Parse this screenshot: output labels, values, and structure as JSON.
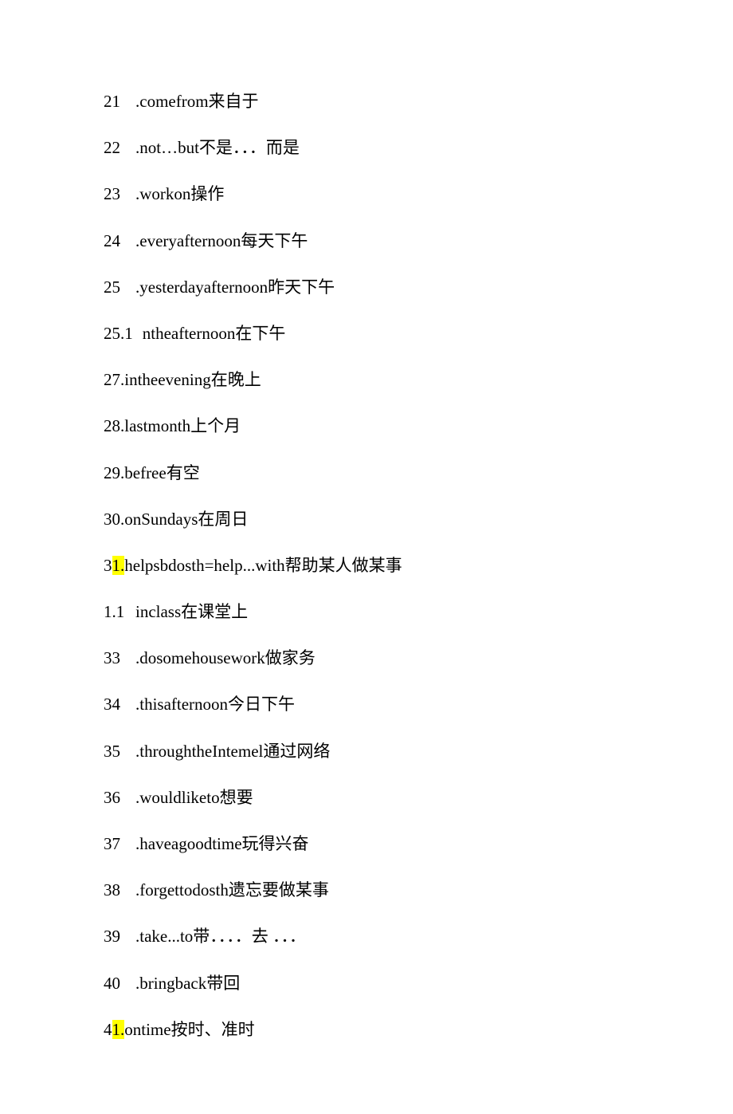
{
  "lines": [
    {
      "num": "21",
      "spaced": true,
      "prehl": "",
      "hl": "",
      "rest": ".comefrom来自于"
    },
    {
      "num": "22",
      "spaced": true,
      "prehl": "",
      "hl": "",
      "rest": ".not…but不是．．．而是"
    },
    {
      "num": "23",
      "spaced": true,
      "prehl": "",
      "hl": "",
      "rest": ".workon操作"
    },
    {
      "num": "24",
      "spaced": true,
      "prehl": "",
      "hl": "",
      "rest": ".everyafternoon每天下午"
    },
    {
      "num": "25",
      "spaced": true,
      "prehl": "",
      "hl": "",
      "rest": ".yesterdayafternoon昨天下午"
    },
    {
      "num": "25.1",
      "spaced": true,
      "prehl": "",
      "hl": "",
      "rest": "ntheafternoon在下午"
    },
    {
      "num": "",
      "spaced": false,
      "prehl": "27.intheevening在晚上",
      "hl": "",
      "rest": ""
    },
    {
      "num": "",
      "spaced": false,
      "prehl": "28.lastmonth上个月",
      "hl": "",
      "rest": ""
    },
    {
      "num": "",
      "spaced": false,
      "prehl": "29.befree有空",
      "hl": "",
      "rest": ""
    },
    {
      "num": "",
      "spaced": false,
      "prehl": "30.onSundays在周日",
      "hl": "",
      "rest": ""
    },
    {
      "num": "",
      "spaced": false,
      "prehl": "3",
      "hl": "1.",
      "rest": "helpsbdosth=help...with帮助某人做某事"
    },
    {
      "num": "1.1",
      "spaced": true,
      "prehl": "",
      "hl": "",
      "rest": "inclass在课堂上"
    },
    {
      "num": "33",
      "spaced": true,
      "prehl": "",
      "hl": "",
      "rest": ".dosomehousework做家务"
    },
    {
      "num": "34",
      "spaced": true,
      "prehl": "",
      "hl": "",
      "rest": ".thisafternoon今日下午"
    },
    {
      "num": "35",
      "spaced": true,
      "prehl": "",
      "hl": "",
      "rest": ".throughtheIntemel通过网络"
    },
    {
      "num": "36",
      "spaced": true,
      "prehl": "",
      "hl": "",
      "rest": ".wouldliketo想要"
    },
    {
      "num": "37",
      "spaced": true,
      "prehl": "",
      "hl": "",
      "rest": ".haveagoodtime玩得兴奋"
    },
    {
      "num": "38",
      "spaced": true,
      "prehl": "",
      "hl": "",
      "rest": ".forgettodosth遗忘要做某事"
    },
    {
      "num": "39",
      "spaced": true,
      "prehl": "",
      "hl": "",
      "rest": ".take...to带．．．．去 ．．．"
    },
    {
      "num": "40",
      "spaced": true,
      "prehl": "",
      "hl": "",
      "rest": ".bringback带回"
    },
    {
      "num": "",
      "spaced": false,
      "prehl": "4",
      "hl": "1.",
      "rest": "ontime按时、准时"
    }
  ]
}
